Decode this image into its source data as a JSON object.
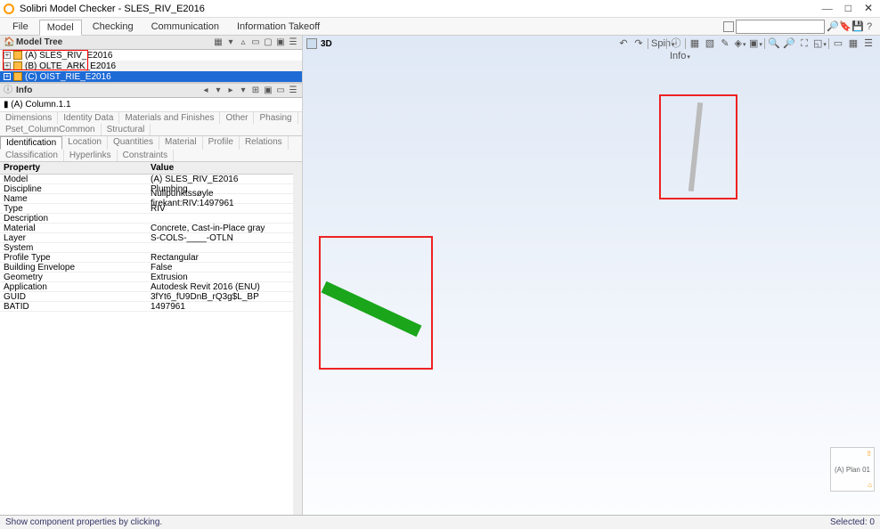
{
  "window": {
    "title": "Solibri Model Checker - SLES_RIV_E2016"
  },
  "menu": {
    "items": [
      "File",
      "Model",
      "Checking",
      "Communication",
      "Information Takeoff"
    ],
    "active_index": 1,
    "search_placeholder": ""
  },
  "model_tree": {
    "title": "Model Tree",
    "items": [
      {
        "label": "(A) SLES_RIV_E2016",
        "selected": false
      },
      {
        "label": "(B) OLTE_ARK_E2016",
        "selected": false
      },
      {
        "label": "(C) OIST_RIE_E2016",
        "selected": true
      }
    ]
  },
  "viewport": {
    "title": "3D",
    "spin_label": "Spin",
    "info_label": "Info",
    "nav_label": "(A) Plan 01"
  },
  "info": {
    "title": "Info",
    "subtitle": "(A) Column.1.1",
    "tabs_row1": [
      "Dimensions",
      "Identity Data",
      "Materials and Finishes",
      "Other",
      "Phasing",
      "Pset_ColumnCommon",
      "Structural"
    ],
    "tabs_row2": [
      "Identification",
      "Location",
      "Quantities",
      "Material",
      "Profile",
      "Relations",
      "Classification",
      "Hyperlinks",
      "Constraints"
    ],
    "tabs_row2_active": 0,
    "columns": {
      "property": "Property",
      "value": "Value"
    },
    "props": [
      {
        "k": "Model",
        "v": "(A) SLES_RIV_E2016"
      },
      {
        "k": "Discipline",
        "v": "Plumbing"
      },
      {
        "k": "Name",
        "v": "Nullpunktssøyle firekant:RIV:1497961"
      },
      {
        "k": "Type",
        "v": "RIV"
      },
      {
        "k": "Description",
        "v": ""
      },
      {
        "k": "Material",
        "v": "Concrete, Cast-in-Place gray"
      },
      {
        "k": "Layer",
        "v": "S-COLS-____-OTLN"
      },
      {
        "k": "System",
        "v": ""
      },
      {
        "k": "Profile Type",
        "v": "Rectangular"
      },
      {
        "k": "Building Envelope",
        "v": "False"
      },
      {
        "k": "Geometry",
        "v": "Extrusion"
      },
      {
        "k": "Application",
        "v": "Autodesk Revit 2016 (ENU)"
      },
      {
        "k": "GUID",
        "v": "3fYt6_fU9DnB_rQ3g$L_BP"
      },
      {
        "k": "BATID",
        "v": "1497961"
      }
    ]
  },
  "status": {
    "left": "Show component properties by clicking.",
    "right": "Selected: 0"
  }
}
